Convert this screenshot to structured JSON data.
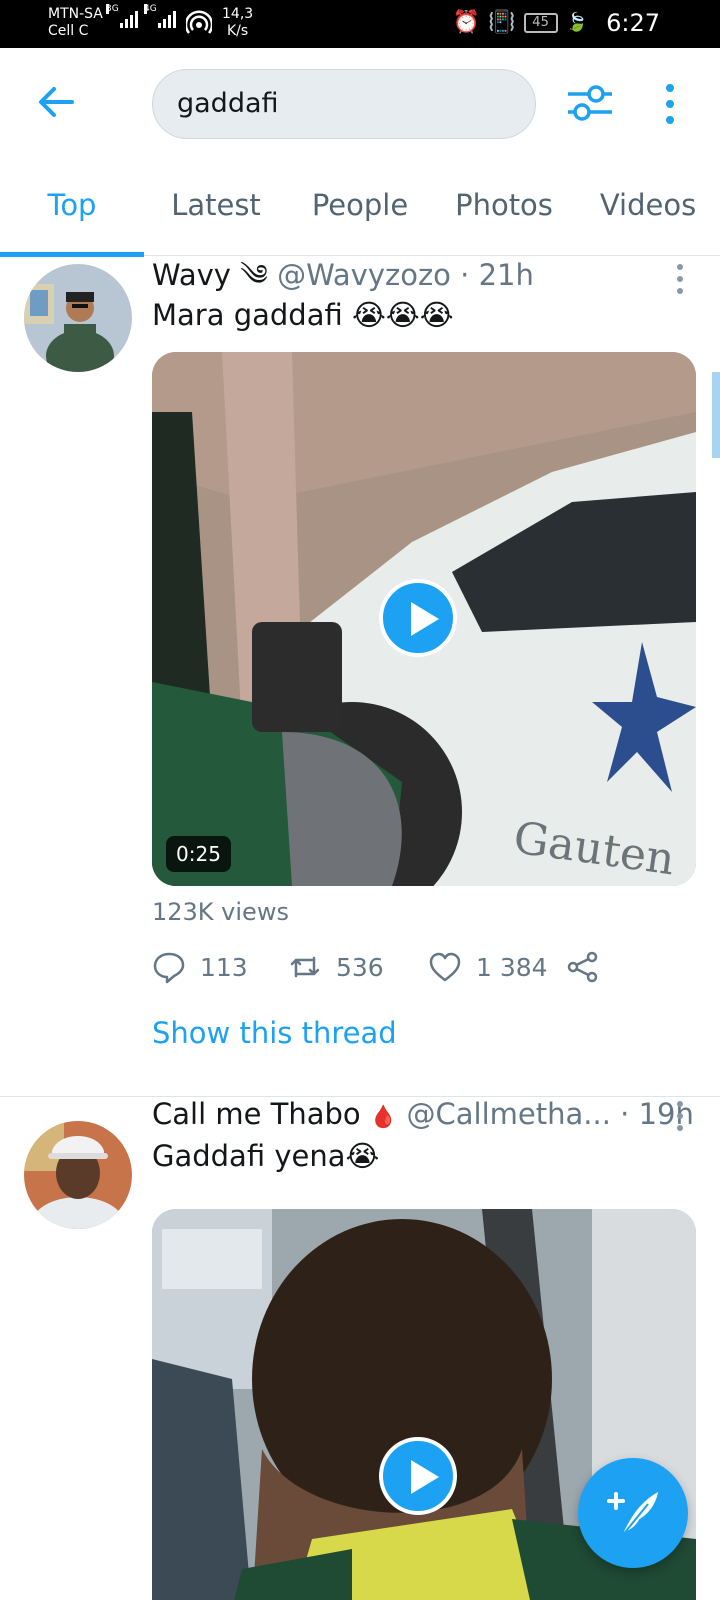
{
  "status_bar": {
    "carrier_1": "MTN-SA",
    "carrier_2": "Cell C",
    "net_1": "3G",
    "net_2": "4G",
    "hotspot_count": "1",
    "speed_value": "14,3",
    "speed_unit": "K/s",
    "battery": "45",
    "time": "6:27"
  },
  "header": {
    "search_value": "gaddafi"
  },
  "tabs": [
    {
      "label": "Top",
      "active": true
    },
    {
      "label": "Latest",
      "active": false
    },
    {
      "label": "People",
      "active": false
    },
    {
      "label": "Photos",
      "active": false
    },
    {
      "label": "Videos",
      "active": false
    }
  ],
  "tweets": [
    {
      "name": "Wavy",
      "name_emoji": "༄",
      "handle": "@Wavyzozo",
      "time": "· 21h",
      "text_pre": "Mara ",
      "text_bold": "gaddafi",
      "text_post": " 😭😭😭",
      "media_type": "video",
      "duration": "0:25",
      "views": "123K views",
      "replies": "113",
      "retweets": "536",
      "likes": "1 384",
      "thread_link": "Show this thread"
    },
    {
      "name": "Call me Thabo",
      "name_emoji": "🩸",
      "handle": "@Callmetha...",
      "time": "· 19h",
      "text_pre": "",
      "text_bold": "Gaddafi",
      "text_post": " yena😭",
      "media_type": "video"
    }
  ],
  "colors": {
    "accent": "#1da1f2",
    "muted": "#657786",
    "text": "#14171a"
  },
  "icons": {
    "back": "arrow-left-icon",
    "filter": "sliders-icon",
    "more": "more-vertical-icon",
    "compose": "compose-tweet-icon"
  }
}
